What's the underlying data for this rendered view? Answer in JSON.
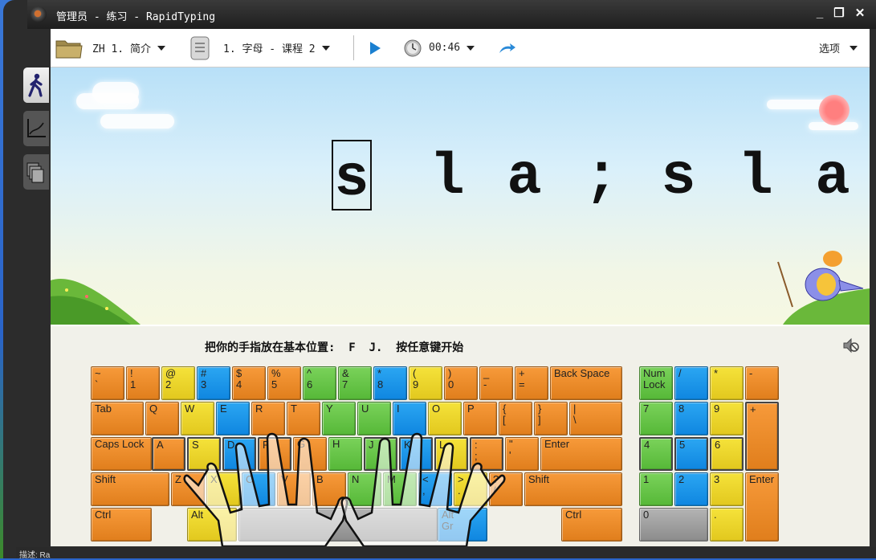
{
  "window": {
    "title": "管理员 - 练习 - RapidTyping",
    "controls": [
      "_",
      "❐",
      "✕"
    ]
  },
  "toolbar": {
    "course": "ZH 1. 简介",
    "lesson": "1. 字母 - 课程 2",
    "timer": "00:46",
    "options": "选项"
  },
  "lesson": {
    "chars": [
      "s",
      "l",
      "a",
      ";",
      "s",
      "l",
      "a"
    ],
    "current_index": 0
  },
  "hint": "把你的手指放在基本位置:  F  J.  按任意键开始",
  "keyboard": {
    "main": [
      [
        "~\n`",
        "!\n1",
        "@\n2",
        "#\n3",
        "$\n4",
        "%\n5",
        "^\n6",
        "&\n7",
        "*\n8",
        "(\n9",
        ")\n0",
        "_\n-",
        "+\n=",
        "Back Space"
      ],
      [
        "Tab",
        "Q",
        "W",
        "E",
        "R",
        "T",
        "Y",
        "U",
        "I",
        "O",
        "P",
        "{\n[",
        "}\n]",
        "|\n\\"
      ],
      [
        "Caps Lock",
        "A",
        "S",
        "D",
        "F",
        "G",
        "H",
        "J",
        "K",
        "L",
        ":\n;",
        "\"\n'",
        "Enter"
      ],
      [
        "Shift",
        "Z",
        "X",
        "C",
        "V",
        "B",
        "N",
        "M",
        "<\n,",
        ">\n.",
        "?\n/",
        "Shift"
      ],
      [
        "Ctrl",
        "Alt",
        "",
        "Alt\nGr",
        "Ctrl"
      ]
    ],
    "numpad": [
      [
        "Num\nLock",
        "/",
        "*",
        "-"
      ],
      [
        "7",
        "8",
        "9",
        "+"
      ],
      [
        "4",
        "5",
        "6"
      ],
      [
        "1",
        "2",
        "3",
        "Enter"
      ],
      [
        "0",
        "."
      ]
    ]
  },
  "status": "描述: Ra"
}
